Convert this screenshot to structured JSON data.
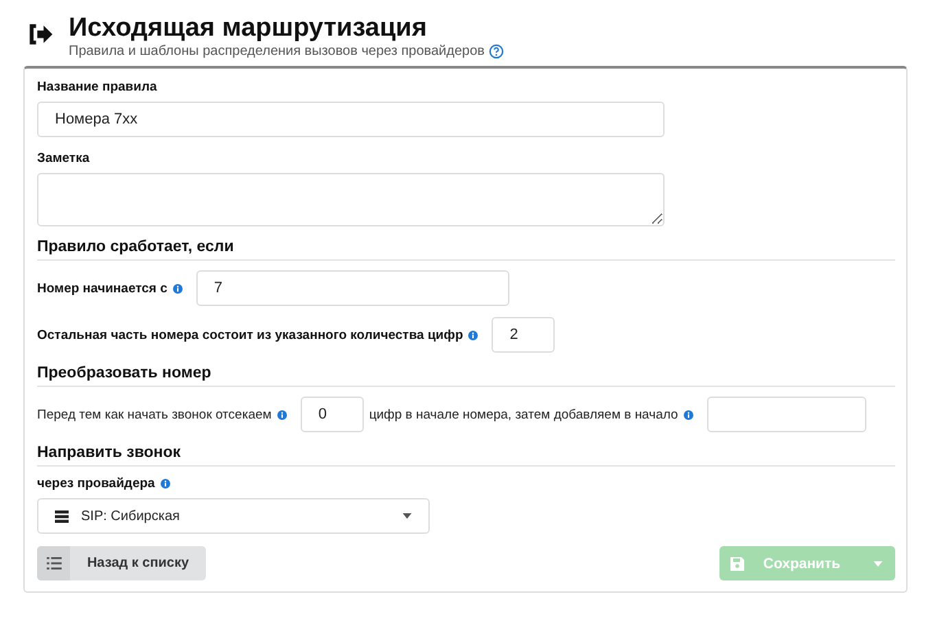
{
  "header": {
    "title": "Исходящая маршрутизация",
    "subtitle": "Правила и шаблоны распределения вызовов через провайдеров"
  },
  "rule_name": {
    "label": "Название правила",
    "value": "Номера 7xx"
  },
  "note": {
    "label": "Заметка"
  },
  "condition": {
    "heading": "Правило сработает, если",
    "starts_with": {
      "label": "Номер начинается с",
      "value": "7"
    },
    "digits": {
      "label": "Остальная часть номера состоит из указанного количества цифр",
      "value": "2"
    }
  },
  "transform": {
    "heading": "Преобразовать номер",
    "before": "Перед тем как начать звонок отсекаем",
    "cut_value": "0",
    "middle": "цифр в начале номера, затем добавляем в начало"
  },
  "route": {
    "heading": "Направить звонок",
    "label": "через провайдера",
    "provider": "SIP: Сибирская"
  },
  "buttons": {
    "back": "Назад к списку",
    "save": "Сохранить",
    "save_disabled": true
  }
}
